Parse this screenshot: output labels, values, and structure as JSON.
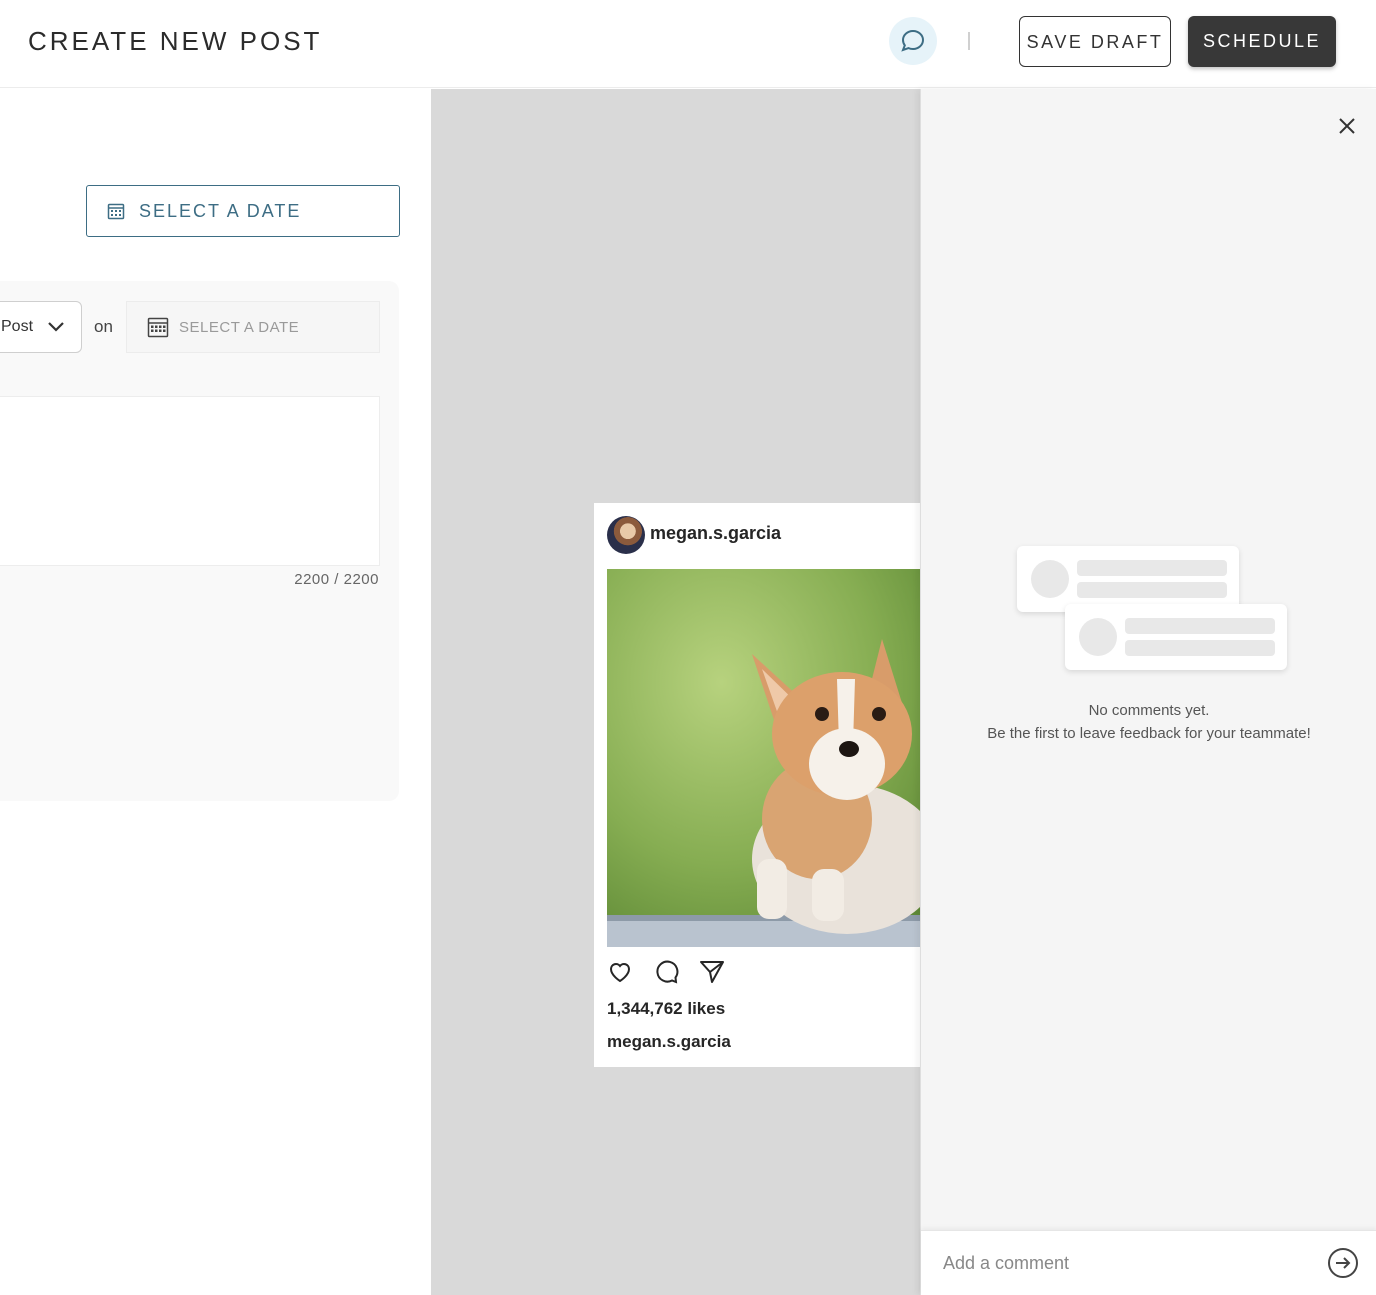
{
  "header": {
    "title": "CREATE NEW POST",
    "save_draft_label": "SAVE DRAFT",
    "schedule_label": "SCHEDULE"
  },
  "left": {
    "select_date_label": "SELECT A DATE",
    "post_type_value": "Post",
    "on_label": "on",
    "date_field_placeholder": "SELECT A DATE",
    "char_count": "2200 / 2200"
  },
  "preview": {
    "username": "megan.s.garcia",
    "likes": "1,344,762 likes",
    "caption_username": "megan.s.garcia"
  },
  "comments": {
    "empty_line1": "No comments yet.",
    "empty_line2": "Be the first to leave feedback for your teammate!",
    "input_placeholder": "Add a comment"
  },
  "colors": {
    "accent": "#3d6d84",
    "schedule_bg": "#383838",
    "preview_bg": "#d9d9d9",
    "comments_bg": "#f5f5f5"
  }
}
